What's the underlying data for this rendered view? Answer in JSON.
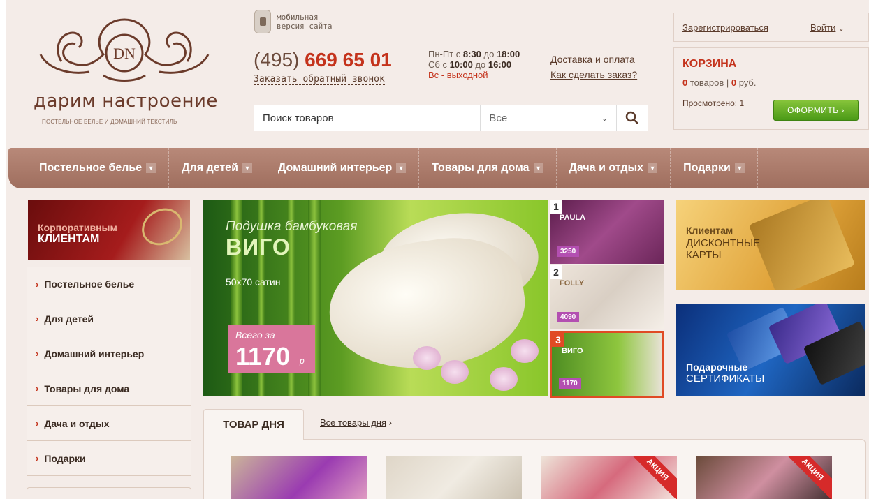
{
  "header": {
    "logo_text": "дарим настроение",
    "logo_sub": "ПОСТЕЛЬНОЕ БЕЛЬЕ И ДОМАШНИЙ ТЕКСТИЛЬ",
    "logo_mark": "DN",
    "mobile_line1": "мобильная",
    "mobile_line2": "версия сайта",
    "phone_code": "(495)",
    "phone_number": "669 65 01",
    "callback": "Заказать обратный звонок",
    "hours_line1_a": "Пн-Пт с ",
    "hours_line1_b": "8:30",
    "hours_line1_c": " до ",
    "hours_line1_d": "18:00",
    "hours_line2_a": "Сб с ",
    "hours_line2_b": "10:00",
    "hours_line2_c": " до ",
    "hours_line2_d": "16:00",
    "hours_line3": "Вс - выходной",
    "link_delivery": "Доставка и оплата",
    "link_how": "Как сделать заказ?",
    "search_placeholder": "Поиск товаров",
    "search_category": "Все",
    "register": "Зарегистрироваться",
    "login": "Войти",
    "cart_title": "КОРЗИНА",
    "cart_items": "0",
    "cart_items_label": " товаров | ",
    "cart_sum": "0",
    "cart_sum_label": " руб.",
    "viewed": "Просмотрено: 1",
    "order_button": "ОФОРМИТЬ"
  },
  "nav": {
    "items": [
      {
        "label": "Постельное белье"
      },
      {
        "label": "Для детей"
      },
      {
        "label": "Домашний интерьер"
      },
      {
        "label": "Товары для дома"
      },
      {
        "label": "Дача и отдых"
      },
      {
        "label": "Подарки"
      }
    ]
  },
  "sidebar": {
    "corp_line1": "Корпоративным",
    "corp_line2": "КЛИЕНТАМ",
    "items": [
      {
        "label": "Постельное белье"
      },
      {
        "label": "Для детей"
      },
      {
        "label": "Домашний интерьер"
      },
      {
        "label": "Товары для дома"
      },
      {
        "label": "Дача и отдых"
      },
      {
        "label": "Подарки"
      }
    ]
  },
  "banner": {
    "subtitle": "Подушка бамбуковая",
    "title": "ВИГО",
    "size": "50x70 сатин",
    "price_label": "Всего за",
    "price": "1170",
    "currency": "р"
  },
  "thumbs": [
    {
      "num": "1",
      "name": "PAULA",
      "price": "3250"
    },
    {
      "num": "2",
      "name": "FOLLY",
      "price": "4090"
    },
    {
      "num": "3",
      "name": "ВИГО",
      "price": "1170"
    }
  ],
  "promo": {
    "disc_line1": "Клиентам",
    "disc_line2": "ДИСКОНТНЫЕ",
    "disc_line3": "КАРТЫ",
    "gift_line1": "Подарочные",
    "gift_line2": "СЕРТИФИКАТЫ"
  },
  "tod": {
    "tab": "ТОВАР ДНЯ",
    "all_link": "Все товары дня",
    "ribbon": "АКЦИЯ"
  }
}
